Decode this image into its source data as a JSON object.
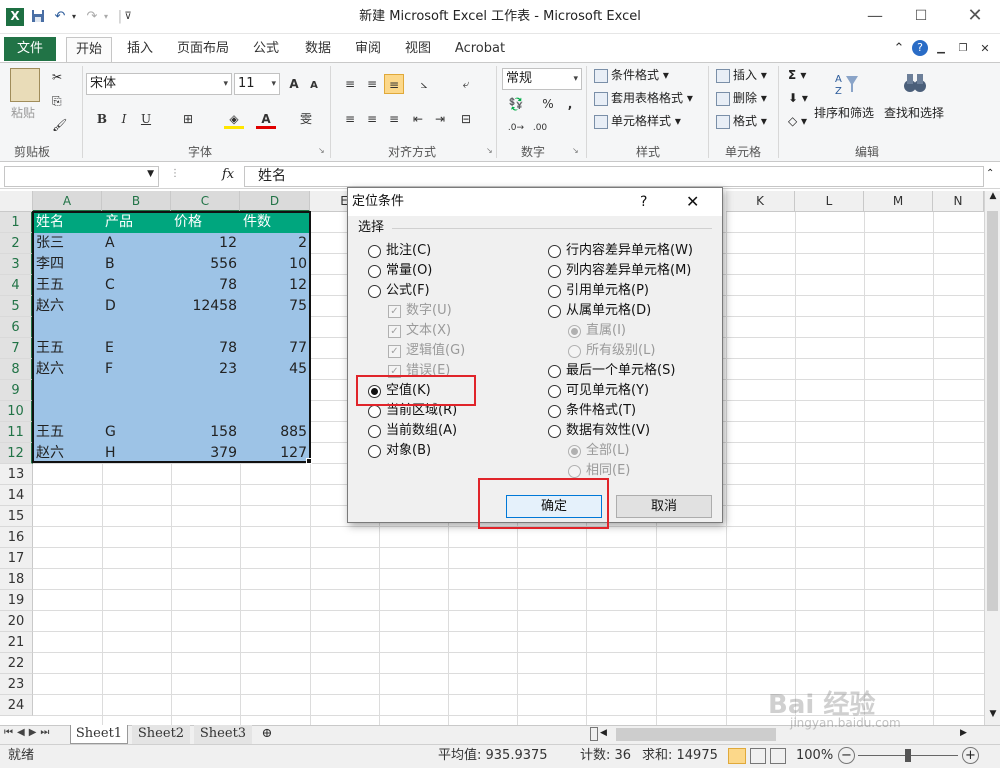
{
  "window": {
    "title": "新建 Microsoft Excel 工作表 - Microsoft Excel",
    "quick_access_icons": [
      "excel-logo-icon",
      "save-icon",
      "undo-icon",
      "redo-icon",
      "customize-qat-icon"
    ]
  },
  "ribbon": {
    "file_tab": "文件",
    "tabs": [
      "开始",
      "插入",
      "页面布局",
      "公式",
      "数据",
      "审阅",
      "视图",
      "Acrobat"
    ],
    "clipboard": {
      "paste": "粘贴",
      "group": "剪贴板"
    },
    "font": {
      "name": "宋体",
      "size": "11",
      "group": "字体",
      "bold": "B",
      "italic": "I",
      "underline": "U",
      "grow": "A",
      "shrink": "A",
      "wen": "雯"
    },
    "alignment": {
      "group": "对齐方式"
    },
    "number": {
      "format": "常规",
      "percent": "%",
      "comma": ",",
      "group": "数字"
    },
    "styles": {
      "conditional": "条件格式",
      "table": "套用表格格式",
      "cell": "单元格样式",
      "group": "样式"
    },
    "cells": {
      "insert": "插入",
      "delete": "删除",
      "format": "格式",
      "group": "单元格"
    },
    "editing": {
      "sum": "Σ",
      "sort": "排序和筛选",
      "find": "查找和选择",
      "group": "编辑"
    }
  },
  "formula_bar": {
    "name_box": "",
    "fx": "fx",
    "content": "姓名"
  },
  "sheet": {
    "columns": [
      "A",
      "B",
      "C",
      "D",
      "E",
      "K",
      "L",
      "M",
      "N"
    ],
    "rows": [
      "1",
      "2",
      "3",
      "4",
      "5",
      "6",
      "7",
      "8",
      "9",
      "10",
      "11",
      "12",
      "13",
      "14",
      "15",
      "16",
      "17",
      "18",
      "19",
      "20",
      "21",
      "22",
      "23",
      "24"
    ],
    "header_row": [
      "姓名",
      "产品",
      "价格",
      "件数"
    ],
    "data": [
      [
        "张三",
        "A",
        "12",
        "2"
      ],
      [
        "李四",
        "B",
        "556",
        "10"
      ],
      [
        "王五",
        "C",
        "78",
        "12"
      ],
      [
        "赵六",
        "D",
        "12458",
        "75"
      ],
      [
        "",
        "",
        "",
        ""
      ],
      [
        "王五",
        "E",
        "78",
        "77"
      ],
      [
        "赵六",
        "F",
        "23",
        "45"
      ],
      [
        "",
        "",
        "",
        ""
      ],
      [
        "",
        "",
        "",
        ""
      ],
      [
        "王五",
        "G",
        "158",
        "885"
      ],
      [
        "赵六",
        "H",
        "379",
        "127"
      ]
    ],
    "colors": {
      "header_fill": "#00a67e",
      "selection_fill": "#9dc3e6",
      "accent": "#217346",
      "highlight": "#e0242a"
    }
  },
  "sheet_tabs": [
    "Sheet1",
    "Sheet2",
    "Sheet3"
  ],
  "status_bar": {
    "ready": "就绪",
    "average": "平均值: 935.9375",
    "count": "计数: 36",
    "sum": "求和: 14975",
    "zoom": "100%",
    "zoom_minus": "−",
    "zoom_plus": "+"
  },
  "dialog": {
    "title": "定位条件",
    "help": "?",
    "section": "选择",
    "left_options": [
      {
        "label": "批注(C)",
        "checked": false
      },
      {
        "label": "常量(O)",
        "checked": false
      },
      {
        "label": "公式(F)",
        "checked": false
      },
      {
        "label": "数字(U)",
        "sub": true
      },
      {
        "label": "文本(X)",
        "sub": true
      },
      {
        "label": "逻辑值(G)",
        "sub": true
      },
      {
        "label": "错误(E)",
        "sub": true
      },
      {
        "label": "空值(K)",
        "checked": true
      },
      {
        "label": "当前区域(R)",
        "checked": false
      },
      {
        "label": "当前数组(A)",
        "checked": false
      },
      {
        "label": "对象(B)",
        "checked": false
      }
    ],
    "right_options": [
      {
        "label": "行内容差异单元格(W)",
        "checked": false
      },
      {
        "label": "列内容差异单元格(M)",
        "checked": false
      },
      {
        "label": "引用单元格(P)",
        "checked": false
      },
      {
        "label": "从属单元格(D)",
        "checked": false
      },
      {
        "label": "直属(I)",
        "sub": true,
        "checked": true
      },
      {
        "label": "所有级别(L)",
        "sub": true,
        "checked": false
      },
      {
        "label": "最后一个单元格(S)",
        "checked": false
      },
      {
        "label": "可见单元格(Y)",
        "checked": false
      },
      {
        "label": "条件格式(T)",
        "checked": false
      },
      {
        "label": "数据有效性(V)",
        "checked": false
      },
      {
        "label": "全部(L)",
        "sub": true,
        "checked": true
      },
      {
        "label": "相同(E)",
        "sub": true,
        "checked": false
      }
    ],
    "ok": "确定",
    "cancel": "取消"
  },
  "watermark": {
    "text": "Bai 经验",
    "url": "jingyan.baidu.com"
  }
}
